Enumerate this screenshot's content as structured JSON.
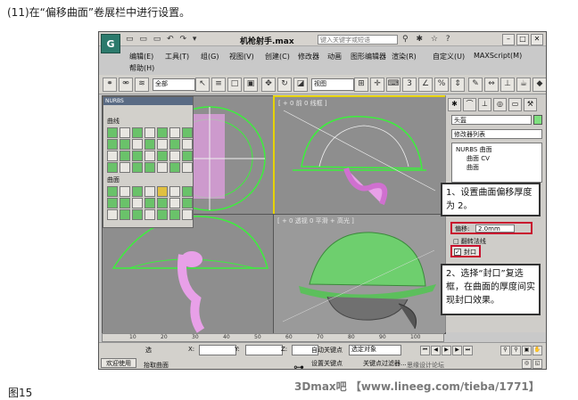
{
  "caption": "(11)在“偏移曲面”卷展栏中进行设置。",
  "figure_label": "图15",
  "watermark": "3Dmax吧 【www.lineeg.com/tieba/1771】",
  "app": {
    "logo": "G",
    "title": "机枪射手.max",
    "search_placeholder": "键入关键字或短语",
    "quick_icons": "▭ ▭ ▭ ↶ ↷ ▾"
  },
  "menu": {
    "row1": [
      "编辑(E)",
      "工具(T)",
      "组(G)",
      "视图(V)",
      "创建(C)",
      "修改器",
      "动画",
      "图形编辑器",
      "渲染(R)",
      "自定义(U)",
      "MAXScript(M)"
    ],
    "row2": [
      "帮助(H)"
    ]
  },
  "toolbar": {
    "filter_combo": "全部",
    "view_combo": "视图"
  },
  "palette": {
    "title": "NURBS",
    "curves_label": "曲线",
    "surfaces_label": "曲面"
  },
  "viewports": {
    "top_right_label": "[ + 0 前 0 线框 ]",
    "bottom_right_label": "[ + 0 透视 0 平滑 + 高光 ]"
  },
  "command_panel": {
    "object_name": "头盔",
    "modifier_list": "修改器列表",
    "stack": [
      "NURBS 曲面",
      "曲面 CV",
      "曲面"
    ],
    "offset_label": "偏移:",
    "offset_value": "2.0mm",
    "flip_normal_label": "翻转法线",
    "cap_label": "封口"
  },
  "callouts": {
    "first": "1、设置曲面偏移厚度为 2。",
    "second": "2、选择“封口”复选框，在曲面的厚度间实现封口效果。"
  },
  "timeline": {
    "ticks": [
      "10",
      "20",
      "30",
      "40",
      "50",
      "60",
      "70",
      "80",
      "90",
      "100"
    ]
  },
  "status": {
    "select_label": "选",
    "x_label": "X:",
    "y_label": "Y:",
    "z_label": "Z:",
    "auto_key": "自动关键点",
    "selected_object": "选定对象",
    "set_key": "设置关键点",
    "key_filter": "关键点过滤器...",
    "welcome": "欢迎使用 ",
    "prompt": "抬取曲面",
    "forum": "思缘设计论坛"
  }
}
